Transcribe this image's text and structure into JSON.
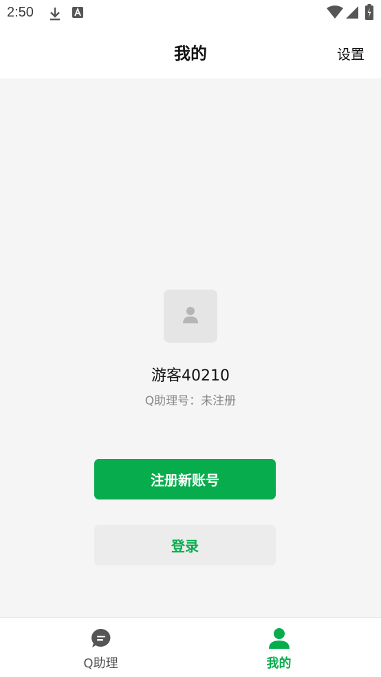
{
  "status_bar": {
    "time": "2:50",
    "icons": [
      "download-icon",
      "a-notification-icon",
      "wifi-icon",
      "signal-icon",
      "battery-icon"
    ]
  },
  "header": {
    "title": "我的",
    "settings_label": "设置"
  },
  "profile": {
    "username": "游客40210",
    "assistant_id": "Q助理号：未注册"
  },
  "actions": {
    "register_label": "注册新账号",
    "login_label": "登录"
  },
  "bottom_nav": {
    "items": [
      {
        "label": "Q助理",
        "icon": "chat-bubble-icon",
        "active": false
      },
      {
        "label": "我的",
        "icon": "person-icon",
        "active": true
      }
    ]
  },
  "colors": {
    "accent": "#07ad4c",
    "background": "#f5f5f5",
    "secondary_button": "#ececec"
  }
}
